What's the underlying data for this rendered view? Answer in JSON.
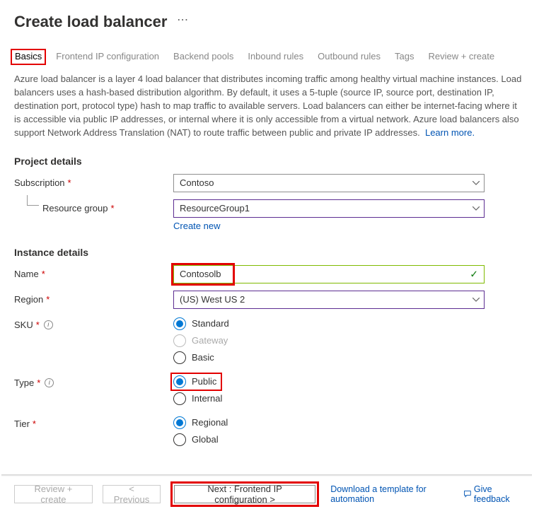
{
  "header": {
    "title": "Create load balancer"
  },
  "tabs": [
    {
      "label": "Basics",
      "active": true
    },
    {
      "label": "Frontend IP configuration"
    },
    {
      "label": "Backend pools"
    },
    {
      "label": "Inbound rules"
    },
    {
      "label": "Outbound rules"
    },
    {
      "label": "Tags"
    },
    {
      "label": "Review + create"
    }
  ],
  "description": "Azure load balancer is a layer 4 load balancer that distributes incoming traffic among healthy virtual machine instances. Load balancers uses a hash-based distribution algorithm. By default, it uses a 5-tuple (source IP, source port, destination IP, destination port, protocol type) hash to map traffic to available servers. Load balancers can either be internet-facing where it is accessible via public IP addresses, or internal where it is only accessible from a virtual network. Azure load balancers also support Network Address Translation (NAT) to route traffic between public and private IP addresses.",
  "learn_more": "Learn more.",
  "sections": {
    "project": {
      "title": "Project details",
      "subscription_label": "Subscription",
      "subscription_value": "Contoso",
      "resource_group_label": "Resource group",
      "resource_group_value": "ResourceGroup1",
      "create_new": "Create new"
    },
    "instance": {
      "title": "Instance details",
      "name_label": "Name",
      "name_value": "Contosolb",
      "region_label": "Region",
      "region_value": "(US) West US 2",
      "sku_label": "SKU",
      "sku_options": {
        "standard": "Standard",
        "gateway": "Gateway",
        "basic": "Basic"
      },
      "type_label": "Type",
      "type_options": {
        "public": "Public",
        "internal": "Internal"
      },
      "tier_label": "Tier",
      "tier_options": {
        "regional": "Regional",
        "global": "Global"
      }
    }
  },
  "footer": {
    "review": "Review + create",
    "previous": "< Previous",
    "next": "Next : Frontend IP configuration >",
    "download": "Download a template for automation",
    "feedback": "Give feedback"
  }
}
